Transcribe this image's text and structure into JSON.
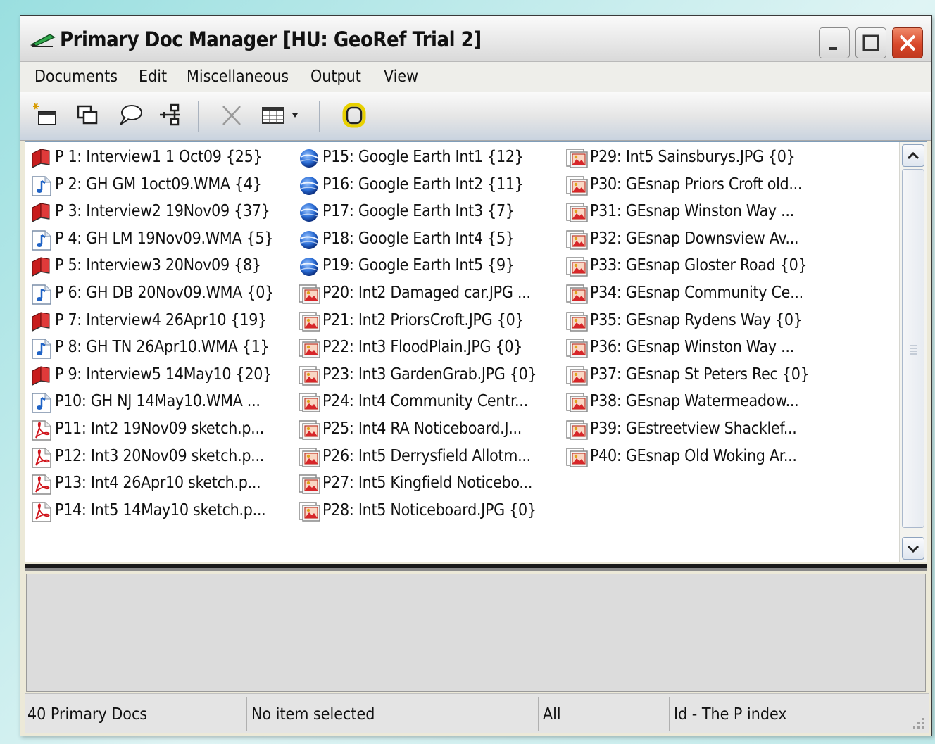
{
  "window": {
    "title": "Primary Doc Manager [HU: GeoRef Trial 2]"
  },
  "menu": [
    "Documents",
    "Edit",
    "Miscellaneous",
    "Output",
    "View"
  ],
  "toolbar": {
    "tools": [
      "new-document-icon",
      "duplicate-icon",
      "comment-icon",
      "tree-icon",
      "cut-icon",
      "grid-view-icon",
      "highlight-ring-icon"
    ]
  },
  "documents": {
    "col1": [
      {
        "label": "P 1: Interview1 1 Oct09 {25}",
        "type": "rtf"
      },
      {
        "label": "P 2: GH GM 1oct09.WMA {4}",
        "type": "audio"
      },
      {
        "label": "P 3: Interview2 19Nov09 {37}",
        "type": "rtf"
      },
      {
        "label": "P 4: GH LM 19Nov09.WMA {5}",
        "type": "audio"
      },
      {
        "label": "P 5: Interview3 20Nov09 {8}",
        "type": "rtf"
      },
      {
        "label": "P 6: GH DB 20Nov09.WMA {0}",
        "type": "audio"
      },
      {
        "label": "P 7: Interview4 26Apr10 {19}",
        "type": "rtf"
      },
      {
        "label": "P 8: GH TN 26Apr10.WMA {1}",
        "type": "audio"
      },
      {
        "label": "P 9: Interview5 14May10 {20}",
        "type": "rtf"
      },
      {
        "label": "P10: GH NJ 14May10.WMA ...",
        "type": "audio"
      },
      {
        "label": "P11: Int2 19Nov09 sketch.p...",
        "type": "pdf"
      },
      {
        "label": "P12: Int3 20Nov09 sketch.p...",
        "type": "pdf"
      },
      {
        "label": "P13: Int4 26Apr10 sketch.p...",
        "type": "pdf"
      },
      {
        "label": "P14: Int5 14May10 sketch.p...",
        "type": "pdf"
      }
    ],
    "col2": [
      {
        "label": "P15: Google Earth Int1 {12}",
        "type": "earth"
      },
      {
        "label": "P16: Google Earth Int2 {11}",
        "type": "earth"
      },
      {
        "label": "P17: Google Earth Int3 {7}",
        "type": "earth"
      },
      {
        "label": "P18: Google Earth Int4 {5}",
        "type": "earth"
      },
      {
        "label": "P19: Google Earth Int5 {9}",
        "type": "earth"
      },
      {
        "label": "P20: Int2 Damaged car.JPG ...",
        "type": "image"
      },
      {
        "label": "P21: Int2 PriorsCroft.JPG {0}",
        "type": "image"
      },
      {
        "label": "P22: Int3 FloodPlain.JPG {0}",
        "type": "image"
      },
      {
        "label": "P23: Int3 GardenGrab.JPG {0}",
        "type": "image"
      },
      {
        "label": "P24: Int4 Community Centr...",
        "type": "image"
      },
      {
        "label": "P25: Int4 RA Noticeboard.J...",
        "type": "image"
      },
      {
        "label": "P26: Int5 Derrysfield Allotm...",
        "type": "image"
      },
      {
        "label": "P27: Int5 Kingfield Noticebo...",
        "type": "image"
      },
      {
        "label": "P28: Int5 Noticeboard.JPG {0}",
        "type": "image"
      }
    ],
    "col3": [
      {
        "label": "P29: Int5 Sainsburys.JPG {0}",
        "type": "image"
      },
      {
        "label": "P30: GEsnap Priors Croft old...",
        "type": "image"
      },
      {
        "label": "P31: GEsnap Winston Way ...",
        "type": "image"
      },
      {
        "label": "P32: GEsnap Downsview Av...",
        "type": "image"
      },
      {
        "label": "P33: GEsnap Gloster Road {0}",
        "type": "image"
      },
      {
        "label": "P34: GEsnap Community Ce...",
        "type": "image"
      },
      {
        "label": "P35: GEsnap Rydens Way {0}",
        "type": "image"
      },
      {
        "label": "P36: GEsnap Winston Way ...",
        "type": "image"
      },
      {
        "label": "P37: GEsnap St Peters Rec {0}",
        "type": "image"
      },
      {
        "label": "P38: GEsnap Watermeadow...",
        "type": "image"
      },
      {
        "label": "P39: GEstreetview Shacklef...",
        "type": "image"
      },
      {
        "label": "P40: GEsnap Old Woking Ar...",
        "type": "image"
      }
    ]
  },
  "status": {
    "count": "40 Primary Docs",
    "selection": "No item selected",
    "filter": "All",
    "sort": "Id - The P index"
  }
}
